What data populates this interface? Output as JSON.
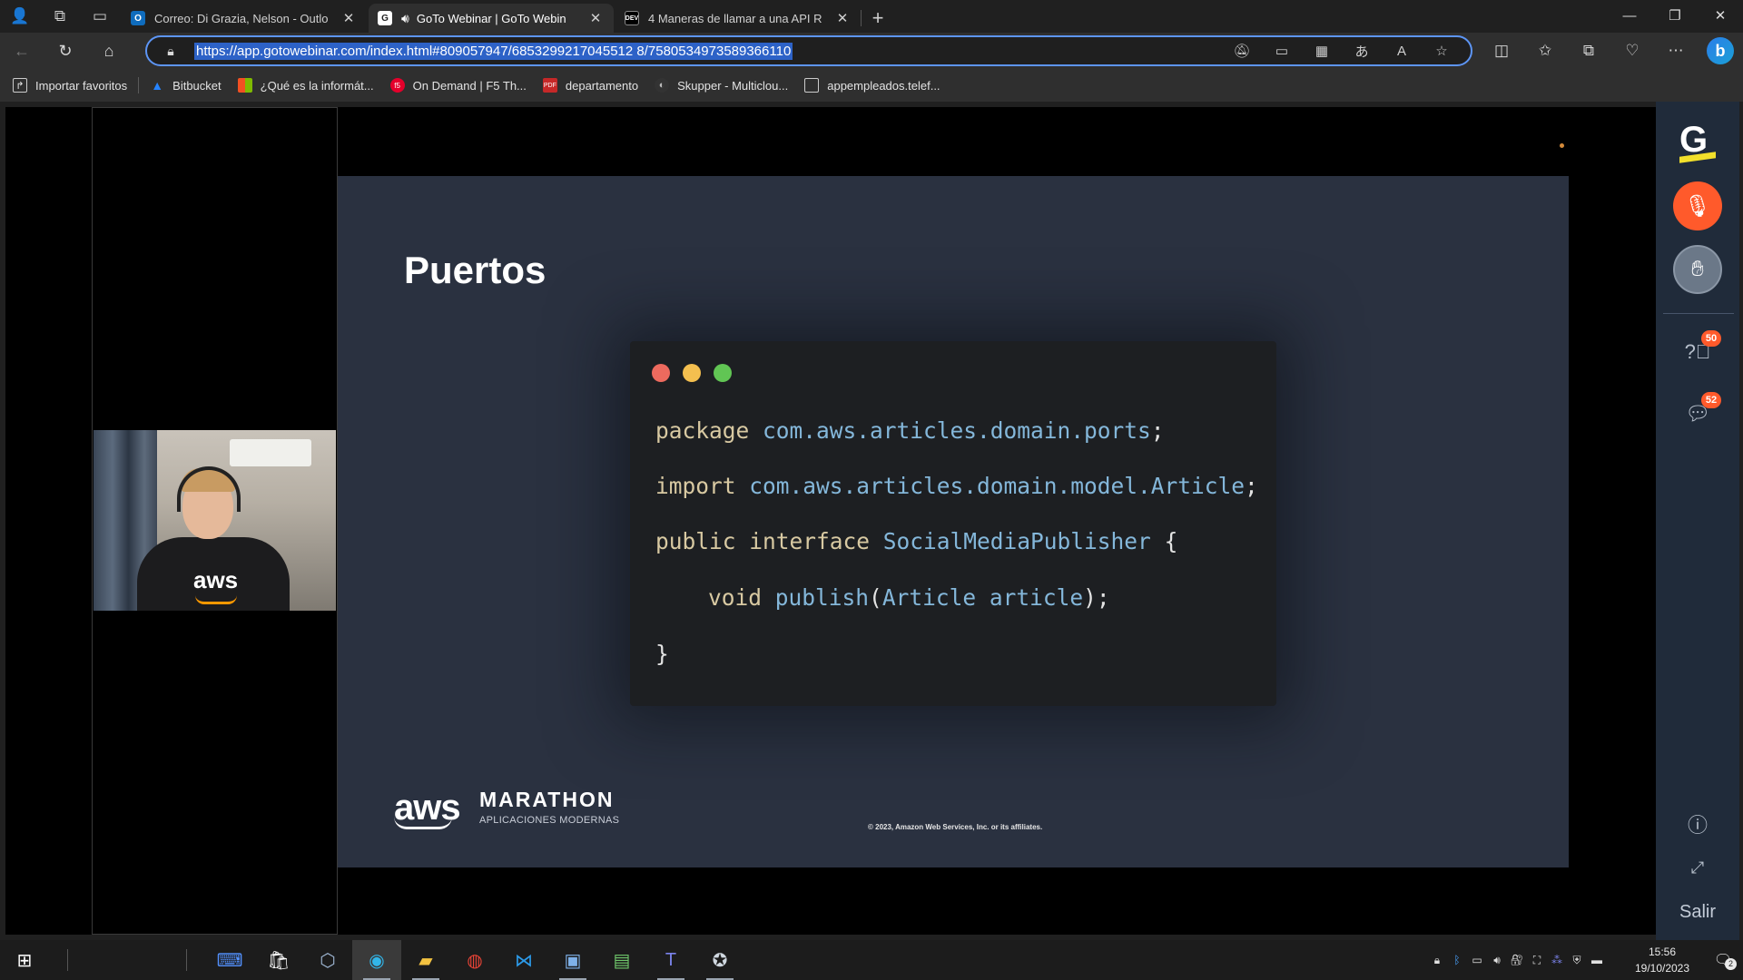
{
  "browser": {
    "tabs": [
      {
        "title": "Correo: Di Grazia, Nelson - Outlo",
        "favicon": "outlook-icon",
        "active": false
      },
      {
        "title": "GoTo Webinar | GoTo Webin",
        "favicon": "goto-icon",
        "active": true,
        "audio": true
      },
      {
        "title": "4 Maneras de llamar a una API R",
        "favicon": "dev-icon",
        "active": false
      }
    ],
    "new_tab": "+",
    "url": "https://app.gotowebinar.com/index.html#809057947/6853299217045512 8/7580534973589366110"
  },
  "bookmarks": [
    {
      "label": "Importar favoritos",
      "icon": "import-icon"
    },
    {
      "label": "Bitbucket",
      "icon": "bitbucket-icon"
    },
    {
      "label": "¿Qué es la informát...",
      "icon": "microsoft-icon"
    },
    {
      "label": "On Demand | F5 Th...",
      "icon": "f5-icon"
    },
    {
      "label": "departamento",
      "icon": "pdf-icon"
    },
    {
      "label": "Skupper - Multiclou...",
      "icon": "skupper-icon"
    },
    {
      "label": "appempleados.telef...",
      "icon": "page-icon"
    }
  ],
  "slide": {
    "title": "Puertos",
    "code": {
      "line1_kw": "package",
      "line1_id": "com.aws.articles.domain.ports",
      "line1_end": ";",
      "line2_kw": "import",
      "line2_id": "com.aws.articles.domain.model.Article",
      "line2_end": ";",
      "line3_kw": "public interface",
      "line3_id": "SocialMediaPublisher",
      "line3_end": "{",
      "line4_kw": "void",
      "line4_id1": "publish",
      "line4_p1": "(",
      "line4_id2": "Article article",
      "line4_end": ");",
      "line5": "}"
    },
    "brand_aws": "aws",
    "brand_event": "MARATHON",
    "brand_sub": "APLICACIONES MODERNAS",
    "copyright": "© 2023, Amazon Web Services, Inc. or its affiliates."
  },
  "webcam": {
    "shirt_text": "aws"
  },
  "goto_panel": {
    "logo": "G",
    "questions_count": "50",
    "chat_count": "52",
    "exit_label": "Salir"
  },
  "taskbar": {
    "time": "15:56",
    "date": "19/10/2023",
    "notifications": "2"
  },
  "colors": {
    "slide_bg": "#2a3140",
    "code_bg": "#1d1f22",
    "keyword": "#d8c9a2",
    "identifier": "#84b7da",
    "mic_accent": "#ff5a2b",
    "goto_yellow": "#f2e02b",
    "url_highlight": "#2d62c7"
  }
}
